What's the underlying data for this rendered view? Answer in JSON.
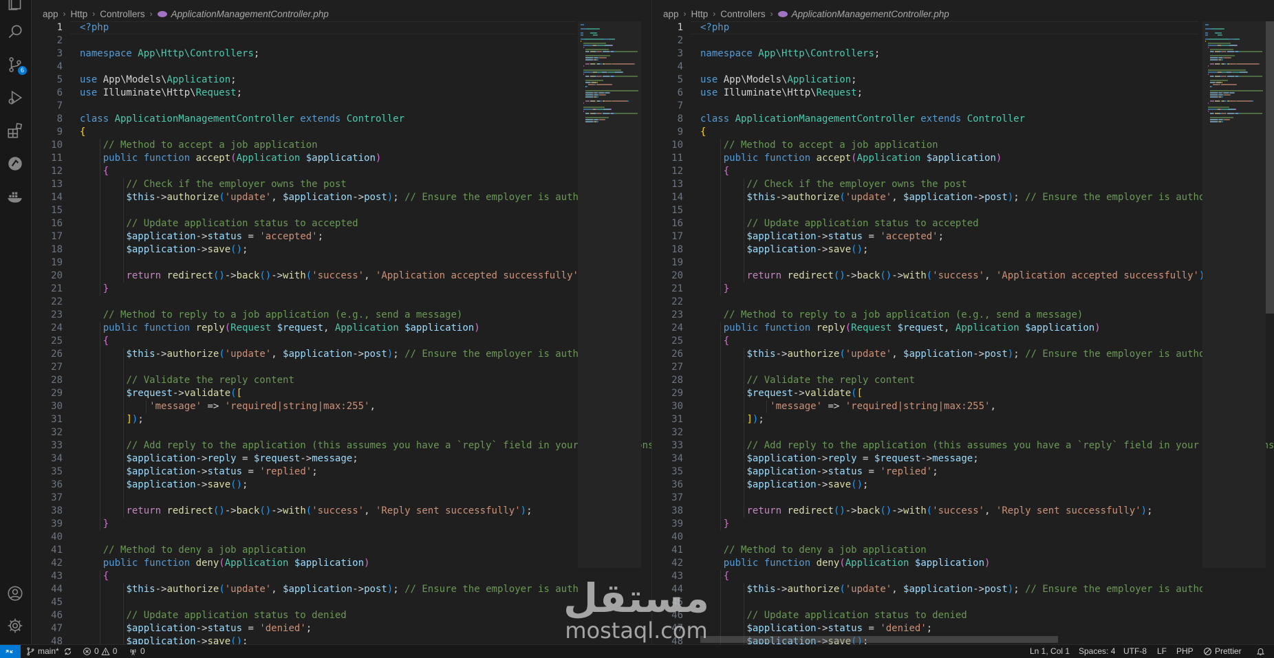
{
  "activity_bar": {
    "icons": [
      "explorer-icon",
      "search-icon",
      "source-control-icon",
      "run-debug-icon",
      "extensions-icon",
      "gitlens-icon",
      "docker-icon"
    ],
    "source_control_badge": "6",
    "bottom_icons": [
      "accounts-icon",
      "settings-gear-icon"
    ]
  },
  "breadcrumb": {
    "segments": [
      "app",
      "Http",
      "Controllers"
    ],
    "file": "ApplicationManagementController.php"
  },
  "editor": {
    "active_line": 1,
    "line_numbers": [
      "1",
      "2",
      "3",
      "4",
      "5",
      "6",
      "7",
      "8",
      "9",
      "10",
      "11",
      "12",
      "13",
      "14",
      "15",
      "16",
      "17",
      "18",
      "19",
      "20",
      "21",
      "22",
      "23",
      "24",
      "25",
      "26",
      "27",
      "28",
      "29",
      "30",
      "31",
      "32",
      "33",
      "34",
      "35",
      "36",
      "37",
      "38",
      "39",
      "40",
      "41",
      "42",
      "43",
      "44",
      "45",
      "46",
      "47",
      "48"
    ],
    "lines": [
      [
        [
          "t",
          "<?php"
        ]
      ],
      [],
      [
        [
          "k",
          "namespace "
        ],
        [
          "c",
          "App\\Http\\Controllers"
        ],
        [
          "o",
          ";"
        ]
      ],
      [],
      [
        [
          "k",
          "use "
        ],
        [
          "x",
          "App\\Models\\"
        ],
        [
          "c",
          "Application"
        ],
        [
          "o",
          ";"
        ]
      ],
      [
        [
          "k",
          "use "
        ],
        [
          "x",
          "Illuminate\\Http\\"
        ],
        [
          "c",
          "Request"
        ],
        [
          "o",
          ";"
        ]
      ],
      [],
      [
        [
          "k",
          "class "
        ],
        [
          "c",
          "ApplicationManagementController "
        ],
        [
          "k",
          "extends "
        ],
        [
          "c",
          "Controller"
        ]
      ],
      [
        [
          "b1",
          "{"
        ]
      ],
      [
        [
          "x",
          "    "
        ],
        [
          "m",
          "// Method to accept a job application"
        ]
      ],
      [
        [
          "x",
          "    "
        ],
        [
          "k",
          "public function "
        ],
        [
          "f",
          "accept"
        ],
        [
          "b2",
          "("
        ],
        [
          "c",
          "Application "
        ],
        [
          "v",
          "$application"
        ],
        [
          "b2",
          ")"
        ]
      ],
      [
        [
          "x",
          "    "
        ],
        [
          "b2",
          "{"
        ]
      ],
      [
        [
          "x",
          "        "
        ],
        [
          "m",
          "// Check if the employer owns the post"
        ]
      ],
      [
        [
          "x",
          "        "
        ],
        [
          "v",
          "$this"
        ],
        [
          "o",
          "->"
        ],
        [
          "f",
          "authorize"
        ],
        [
          "b3",
          "("
        ],
        [
          "s",
          "'update'"
        ],
        [
          "o",
          ", "
        ],
        [
          "v",
          "$application"
        ],
        [
          "o",
          "->"
        ],
        [
          "v",
          "post"
        ],
        [
          "b3",
          ")"
        ],
        [
          "o",
          "; "
        ],
        [
          "m",
          "// Ensure the employer is authorized"
        ]
      ],
      [],
      [
        [
          "x",
          "        "
        ],
        [
          "m",
          "// Update application status to accepted"
        ]
      ],
      [
        [
          "x",
          "        "
        ],
        [
          "v",
          "$application"
        ],
        [
          "o",
          "->"
        ],
        [
          "v",
          "status"
        ],
        [
          "o",
          " = "
        ],
        [
          "s",
          "'accepted'"
        ],
        [
          "o",
          ";"
        ]
      ],
      [
        [
          "x",
          "        "
        ],
        [
          "v",
          "$application"
        ],
        [
          "o",
          "->"
        ],
        [
          "f",
          "save"
        ],
        [
          "b3",
          "()"
        ],
        [
          "o",
          ";"
        ]
      ],
      [],
      [
        [
          "x",
          "        "
        ],
        [
          "r",
          "return "
        ],
        [
          "f",
          "redirect"
        ],
        [
          "b3",
          "()"
        ],
        [
          "o",
          "->"
        ],
        [
          "f",
          "back"
        ],
        [
          "b3",
          "()"
        ],
        [
          "o",
          "->"
        ],
        [
          "f",
          "with"
        ],
        [
          "b3",
          "("
        ],
        [
          "s",
          "'success'"
        ],
        [
          "o",
          ", "
        ],
        [
          "s",
          "'Application accepted successfully'"
        ],
        [
          "b3",
          ")"
        ],
        [
          "o",
          ";"
        ]
      ],
      [
        [
          "x",
          "    "
        ],
        [
          "b2",
          "}"
        ]
      ],
      [],
      [
        [
          "x",
          "    "
        ],
        [
          "m",
          "// Method to reply to a job application (e.g., send a message)"
        ]
      ],
      [
        [
          "x",
          "    "
        ],
        [
          "k",
          "public function "
        ],
        [
          "f",
          "reply"
        ],
        [
          "b2",
          "("
        ],
        [
          "c",
          "Request "
        ],
        [
          "v",
          "$request"
        ],
        [
          "o",
          ", "
        ],
        [
          "c",
          "Application "
        ],
        [
          "v",
          "$application"
        ],
        [
          "b2",
          ")"
        ]
      ],
      [
        [
          "x",
          "    "
        ],
        [
          "b2",
          "{"
        ]
      ],
      [
        [
          "x",
          "        "
        ],
        [
          "v",
          "$this"
        ],
        [
          "o",
          "->"
        ],
        [
          "f",
          "authorize"
        ],
        [
          "b3",
          "("
        ],
        [
          "s",
          "'update'"
        ],
        [
          "o",
          ", "
        ],
        [
          "v",
          "$application"
        ],
        [
          "o",
          "->"
        ],
        [
          "v",
          "post"
        ],
        [
          "b3",
          ")"
        ],
        [
          "o",
          "; "
        ],
        [
          "m",
          "// Ensure the employer is authorized"
        ]
      ],
      [],
      [
        [
          "x",
          "        "
        ],
        [
          "m",
          "// Validate the reply content"
        ]
      ],
      [
        [
          "x",
          "        "
        ],
        [
          "v",
          "$request"
        ],
        [
          "o",
          "->"
        ],
        [
          "f",
          "validate"
        ],
        [
          "b3",
          "("
        ],
        [
          "b1",
          "["
        ]
      ],
      [
        [
          "x",
          "            "
        ],
        [
          "s",
          "'message'"
        ],
        [
          "o",
          " => "
        ],
        [
          "s",
          "'required|string|max:255'"
        ],
        [
          "o",
          ","
        ]
      ],
      [
        [
          "x",
          "        "
        ],
        [
          "b1",
          "]"
        ],
        [
          "b3",
          ")"
        ],
        [
          "o",
          ";"
        ]
      ],
      [],
      [
        [
          "x",
          "        "
        ],
        [
          "m",
          "// Add reply to the application (this assumes you have a `reply` field in your applications table)"
        ]
      ],
      [
        [
          "x",
          "        "
        ],
        [
          "v",
          "$application"
        ],
        [
          "o",
          "->"
        ],
        [
          "v",
          "reply"
        ],
        [
          "o",
          " = "
        ],
        [
          "v",
          "$request"
        ],
        [
          "o",
          "->"
        ],
        [
          "v",
          "message"
        ],
        [
          "o",
          ";"
        ]
      ],
      [
        [
          "x",
          "        "
        ],
        [
          "v",
          "$application"
        ],
        [
          "o",
          "->"
        ],
        [
          "v",
          "status"
        ],
        [
          "o",
          " = "
        ],
        [
          "s",
          "'replied'"
        ],
        [
          "o",
          ";"
        ]
      ],
      [
        [
          "x",
          "        "
        ],
        [
          "v",
          "$application"
        ],
        [
          "o",
          "->"
        ],
        [
          "f",
          "save"
        ],
        [
          "b3",
          "()"
        ],
        [
          "o",
          ";"
        ]
      ],
      [],
      [
        [
          "x",
          "        "
        ],
        [
          "r",
          "return "
        ],
        [
          "f",
          "redirect"
        ],
        [
          "b3",
          "()"
        ],
        [
          "o",
          "->"
        ],
        [
          "f",
          "back"
        ],
        [
          "b3",
          "()"
        ],
        [
          "o",
          "->"
        ],
        [
          "f",
          "with"
        ],
        [
          "b3",
          "("
        ],
        [
          "s",
          "'success'"
        ],
        [
          "o",
          ", "
        ],
        [
          "s",
          "'Reply sent successfully'"
        ],
        [
          "b3",
          ")"
        ],
        [
          "o",
          ";"
        ]
      ],
      [
        [
          "x",
          "    "
        ],
        [
          "b2",
          "}"
        ]
      ],
      [],
      [
        [
          "x",
          "    "
        ],
        [
          "m",
          "// Method to deny a job application"
        ]
      ],
      [
        [
          "x",
          "    "
        ],
        [
          "k",
          "public function "
        ],
        [
          "f",
          "deny"
        ],
        [
          "b2",
          "("
        ],
        [
          "c",
          "Application "
        ],
        [
          "v",
          "$application"
        ],
        [
          "b2",
          ")"
        ]
      ],
      [
        [
          "x",
          "    "
        ],
        [
          "b2",
          "{"
        ]
      ],
      [
        [
          "x",
          "        "
        ],
        [
          "v",
          "$this"
        ],
        [
          "o",
          "->"
        ],
        [
          "f",
          "authorize"
        ],
        [
          "b3",
          "("
        ],
        [
          "s",
          "'update'"
        ],
        [
          "o",
          ", "
        ],
        [
          "v",
          "$application"
        ],
        [
          "o",
          "->"
        ],
        [
          "v",
          "post"
        ],
        [
          "b3",
          ")"
        ],
        [
          "o",
          "; "
        ],
        [
          "m",
          "// Ensure the employer is authorized"
        ]
      ],
      [],
      [
        [
          "x",
          "        "
        ],
        [
          "m",
          "// Update application status to denied"
        ]
      ],
      [
        [
          "x",
          "        "
        ],
        [
          "v",
          "$application"
        ],
        [
          "o",
          "->"
        ],
        [
          "v",
          "status"
        ],
        [
          "o",
          " = "
        ],
        [
          "s",
          "'denied'"
        ],
        [
          "o",
          ";"
        ]
      ],
      [
        [
          "x",
          "        "
        ],
        [
          "v",
          "$application"
        ],
        [
          "o",
          "->"
        ],
        [
          "f",
          "save"
        ],
        [
          "b3",
          "()"
        ],
        [
          "o",
          ";"
        ]
      ]
    ]
  },
  "status_bar": {
    "branch": "main*",
    "errors": "0",
    "warnings": "0",
    "ports": "0",
    "cursor": "Ln 1, Col 1",
    "indent": "Spaces: 4",
    "encoding": "UTF-8",
    "eol": "LF",
    "language": "PHP",
    "formatter": "Prettier"
  },
  "watermark": {
    "arabic": "مستقل",
    "latin": "mostaql.com"
  },
  "colors": {
    "accent": "#0078d4",
    "editor_bg": "#1f1f1f",
    "status_bg": "#181818"
  }
}
